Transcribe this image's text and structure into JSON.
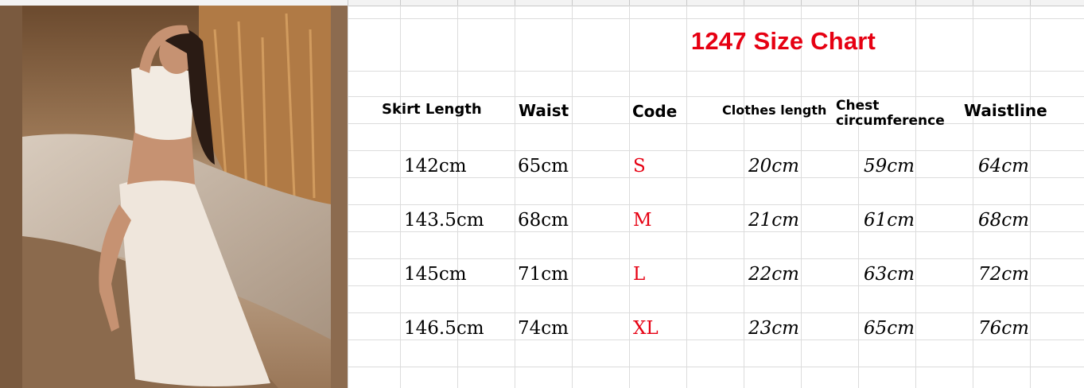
{
  "title": "1247 Size Chart",
  "headers": {
    "skirt_length": "Skirt Length",
    "waist": "Waist",
    "code": "Code",
    "clothes_length": "Clothes length",
    "chest_line1": "Chest",
    "chest_line2": "circumference",
    "waistline": "Waistline"
  },
  "rows": [
    {
      "skirt_length": "142cm",
      "waist": "65cm",
      "code": "S",
      "clothes_length": "20cm",
      "chest": "59cm",
      "waistline": "64cm"
    },
    {
      "skirt_length": "143.5cm",
      "waist": "68cm",
      "code": "M",
      "clothes_length": "21cm",
      "chest": "61cm",
      "waistline": "68cm"
    },
    {
      "skirt_length": "145cm",
      "waist": "71cm",
      "code": "L",
      "clothes_length": "22cm",
      "chest": "63cm",
      "waistline": "72cm"
    },
    {
      "skirt_length": "146.5cm",
      "waist": "74cm",
      "code": "XL",
      "clothes_length": "23cm",
      "chest": "65cm",
      "waistline": "76cm"
    }
  ],
  "colors": {
    "title": "#e60012",
    "code": "#e60012",
    "grid": "#dcdcdc"
  }
}
